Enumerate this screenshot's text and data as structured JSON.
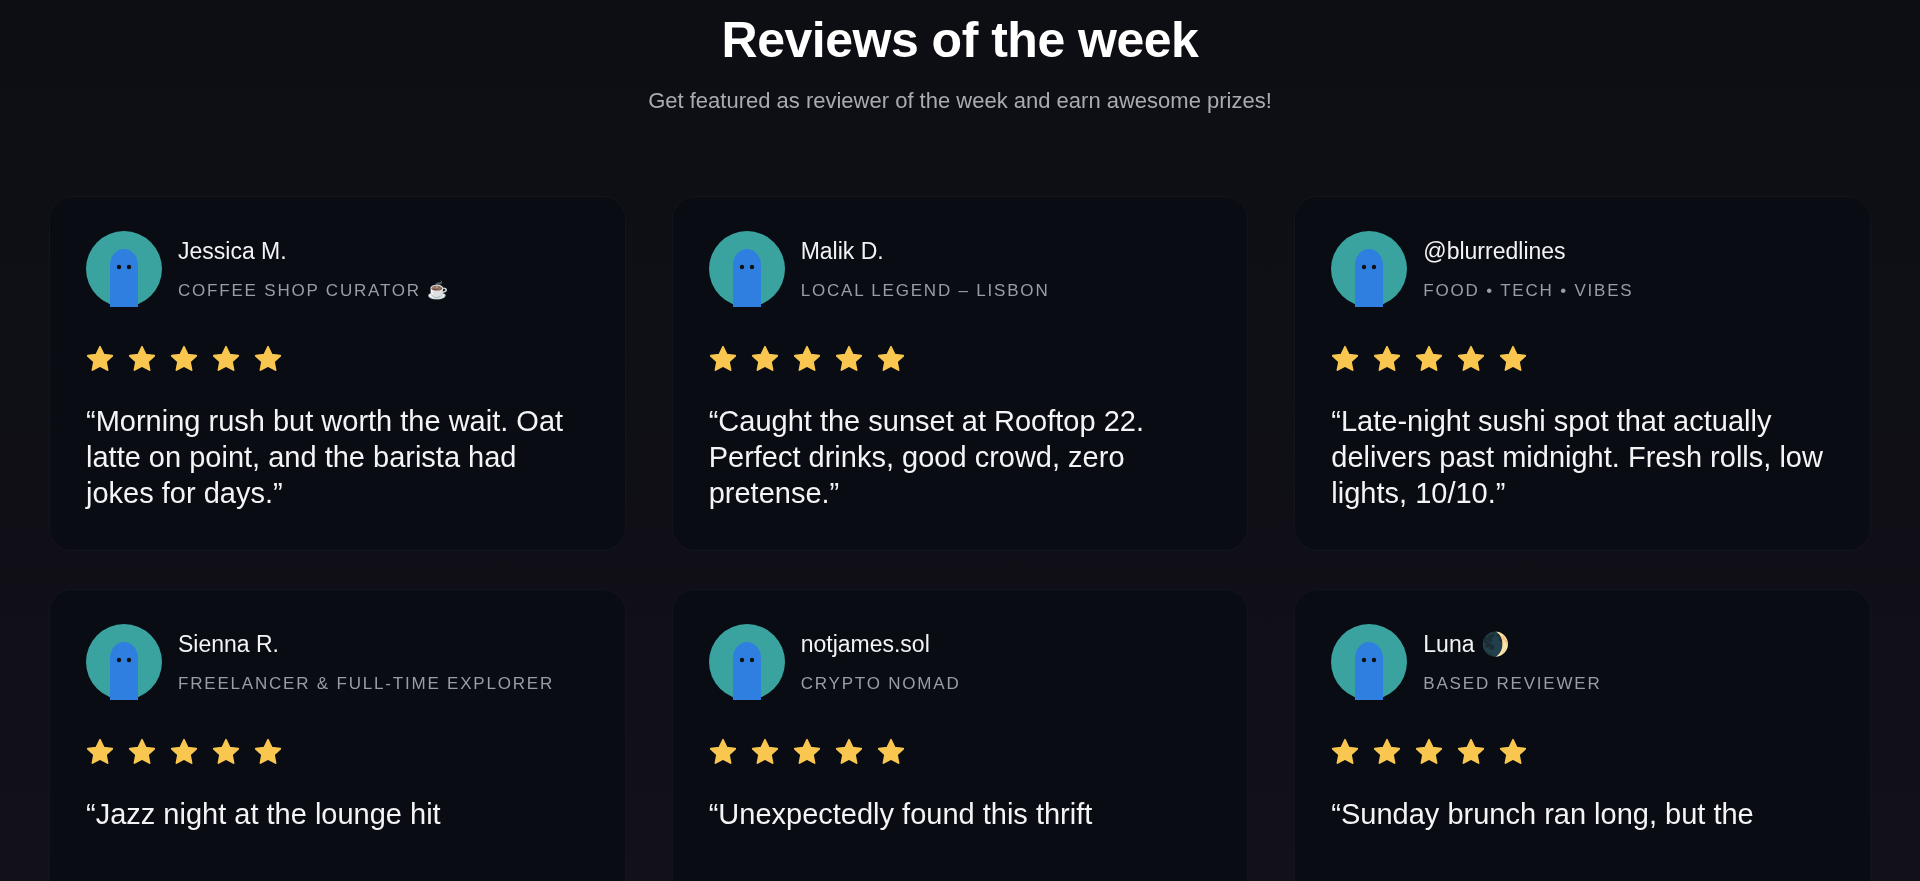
{
  "header": {
    "title": "Reviews of the week",
    "subtitle": "Get featured as reviewer of the week and earn awesome prizes!"
  },
  "reviews": [
    {
      "name": "Jessica M.",
      "tagline": "COFFEE SHOP CURATOR ☕",
      "stars": 5,
      "quote": "“Morning rush but worth the wait. Oat latte on point, and the barista had jokes for days.”"
    },
    {
      "name": "Malik D.",
      "tagline": "LOCAL LEGEND – LISBON",
      "stars": 5,
      "quote": "“Caught the sunset at Rooftop 22. Perfect drinks, good crowd, zero pretense.”"
    },
    {
      "name": "@blurredlines",
      "tagline": "FOOD • TECH • VIBES",
      "stars": 5,
      "quote": "“Late-night sushi spot that actually delivers past midnight. Fresh rolls, low lights, 10/10.”"
    },
    {
      "name": "Sienna R.",
      "tagline": "FREELANCER & FULL-TIME EXPLORER",
      "stars": 5,
      "quote": "“Jazz night at the lounge hit"
    },
    {
      "name": "notjames.sol",
      "tagline": "CRYPTO NOMAD",
      "stars": 5,
      "quote": "“Unexpectedly found this thrift"
    },
    {
      "name": "Luna 🌒",
      "tagline": "BASED REVIEWER",
      "stars": 5,
      "quote": "“Sunday brunch ran long, but the"
    }
  ]
}
